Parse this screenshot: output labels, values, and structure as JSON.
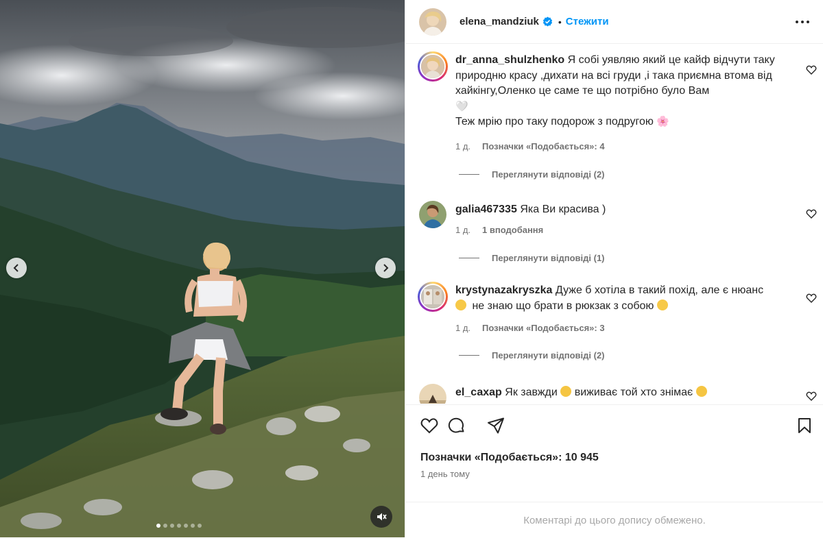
{
  "post": {
    "author": "elena_mandziuk",
    "separator": "•",
    "follow_label": "Стежити",
    "more_icon": "more-horizontal-icon",
    "verified_icon": "verified-badge-icon",
    "likes_text": "Позначки «Подобається»: 10 945",
    "date_text": "1 день тому",
    "comments_limited_text": "Коментарі до цього допису обмежено.",
    "carousel": {
      "prev_icon": "chevron-left-icon",
      "next_icon": "chevron-right-icon",
      "dots_total": 7,
      "active_dot": 0,
      "mute_icon": "speaker-muted-icon"
    }
  },
  "comments": [
    {
      "user": "dr_anna_shulzhenko",
      "text_main": "Я собі уявляю який це кайф відчути таку природню красу ,дихати на всі груди ,і така приємна втома від хайкінгу,Оленко це саме те що потрібно було Вам",
      "text_emoji_1": "🤍",
      "text_line_2": "Теж мрію про таку подорож з подругою",
      "text_emoji_2": "🌸",
      "time": "1 д.",
      "likes": "Позначки «Подобається»: 4",
      "replies": "Переглянути відповіді (2)",
      "has_story_ring": true
    },
    {
      "user": "galia467335",
      "text_main": "Яка Ви красива )",
      "time": "1 д.",
      "likes": "1 вподобання",
      "replies": "Переглянути відповіді (1)",
      "has_story_ring": false
    },
    {
      "user": "krystynazakryszka",
      "text_main": "Дуже б хотіла в такий похід, але є нюанс",
      "text_line_2": "не знаю що брати в рюкзак з собою",
      "time": "1 д.",
      "likes": "Позначки «Подобається»: 3",
      "replies": "Переглянути відповіді (2)",
      "has_story_ring": true
    },
    {
      "user": "el_сахар",
      "text_main": "Як завжди",
      "text_after_emoji": "виживає той хто знімає",
      "has_story_ring": false
    }
  ],
  "actions": {
    "like_icon": "heart-icon",
    "comment_icon": "comment-icon",
    "share_icon": "paper-plane-icon",
    "save_icon": "bookmark-icon"
  },
  "colors": {
    "accent": "#0095f6",
    "text": "#262626",
    "muted": "#737373",
    "divider": "#efefef"
  }
}
